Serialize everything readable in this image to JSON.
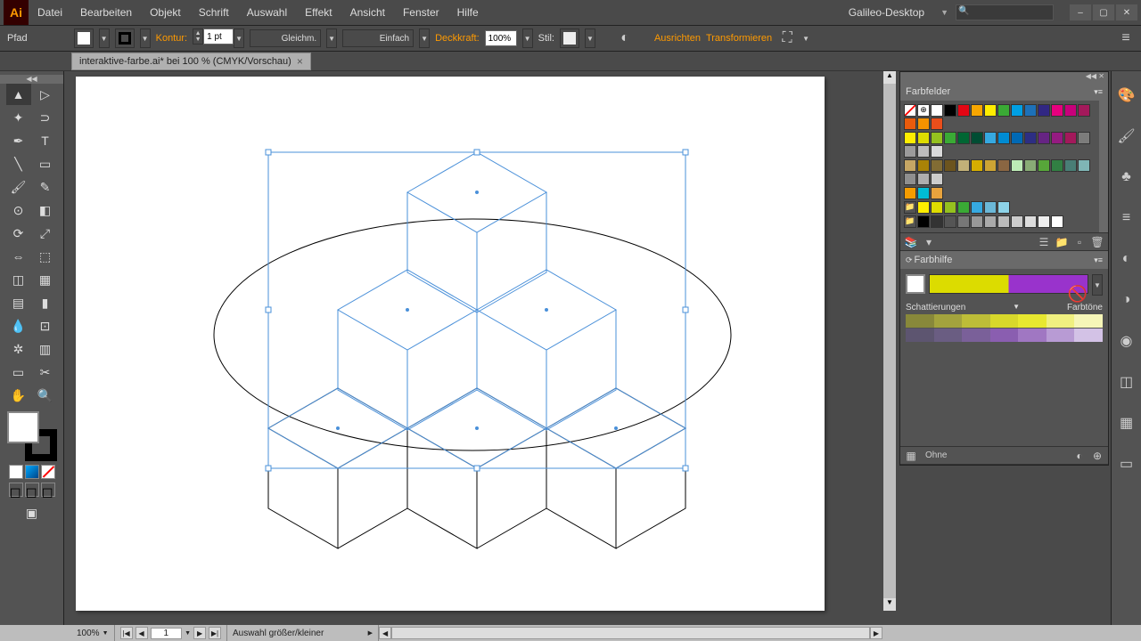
{
  "app": {
    "icon_label": "Ai"
  },
  "menu": {
    "items": [
      "Datei",
      "Bearbeiten",
      "Objekt",
      "Schrift",
      "Auswahl",
      "Effekt",
      "Ansicht",
      "Fenster",
      "Hilfe"
    ],
    "workspace": "Galileo-Desktop"
  },
  "window_buttons": {
    "min": "–",
    "max": "▢",
    "close": "✕"
  },
  "controlbar": {
    "selection_type": "Pfad",
    "stroke_label": "Kontur:",
    "stroke_weight": "1 pt",
    "brush_style": "Gleichm.",
    "profile": "Einfach",
    "opacity_label": "Deckkraft:",
    "opacity_value": "100%",
    "style_label": "Stil:",
    "align_label": "Ausrichten",
    "transform_label": "Transformieren"
  },
  "document": {
    "tab_title": "interaktive-farbe.ai* bei 100 % (CMYK/Vorschau)"
  },
  "panels": {
    "swatches": {
      "title": "Farbfelder",
      "rows": [
        [
          "none",
          "registration",
          "white",
          "black",
          "#e30613",
          "#f7a600",
          "#ffed00",
          "#3aaa35",
          "#009fe3",
          "#1d71b8",
          "#312783",
          "#e6007e",
          "#c8007b",
          "#a3195b",
          "#ea5b0c",
          "#f39200",
          "#e94e1b"
        ],
        [
          "#ffed00",
          "#dedc00",
          "#95c11f",
          "#3aaa35",
          "#006633",
          "#004d33",
          "#36a9e1",
          "#008bd2",
          "#0069b4",
          "#2d2e83",
          "#662483",
          "#951b81",
          "#a3195b",
          "#7c7c7b",
          "#9c9b9b",
          "#bdbcbc",
          "#dadada"
        ],
        [
          "#c6a664",
          "#a98307",
          "#826c34",
          "#6c541e",
          "#c2b078",
          "#d6ae01",
          "#cda434",
          "#8a6642",
          "#bdecb6",
          "#89ac76",
          "#57a639",
          "#317f43",
          "#497e76",
          "#7fb5b5",
          "#8f8f8f",
          "#aeaeae",
          "#cccccc"
        ],
        [
          "#f59c00",
          "#00bcd4",
          "#e8a33d"
        ],
        [
          "folder",
          "#ffed00",
          "#dedc00",
          "#95c11f",
          "#3aaa35",
          "#36a9e1",
          "#6bb8d8",
          "#8dd3e8"
        ],
        [
          "folder",
          "#000000",
          "#333333",
          "#555555",
          "#777777",
          "#999999",
          "#aaaaaa",
          "#bbbbbb",
          "#cccccc",
          "#dddddd",
          "#eeeeee",
          "#ffffff"
        ]
      ]
    },
    "colorguide": {
      "title": "Farbhilfe",
      "base_color": "#ffffff",
      "harmony": [
        "#dcdc00",
        "#8833bb"
      ],
      "label_left": "Schattierungen",
      "label_right": "Farbtöne",
      "ramp1": [
        "#88883a",
        "#a3a33d",
        "#bdbd38",
        "#d8d82b",
        "#e8e830",
        "#f0f080",
        "#f6f6b8"
      ],
      "ramp2": [
        "#5d5570",
        "#6a5d82",
        "#7a6099",
        "#8a5eb0",
        "#a077c2",
        "#b89bd4",
        "#d3c2e6"
      ],
      "footer_text": "Ohne"
    }
  },
  "statusbar": {
    "zoom": "100%",
    "artboard_nav": "1",
    "tool_hint": "Auswahl größer/kleiner"
  }
}
